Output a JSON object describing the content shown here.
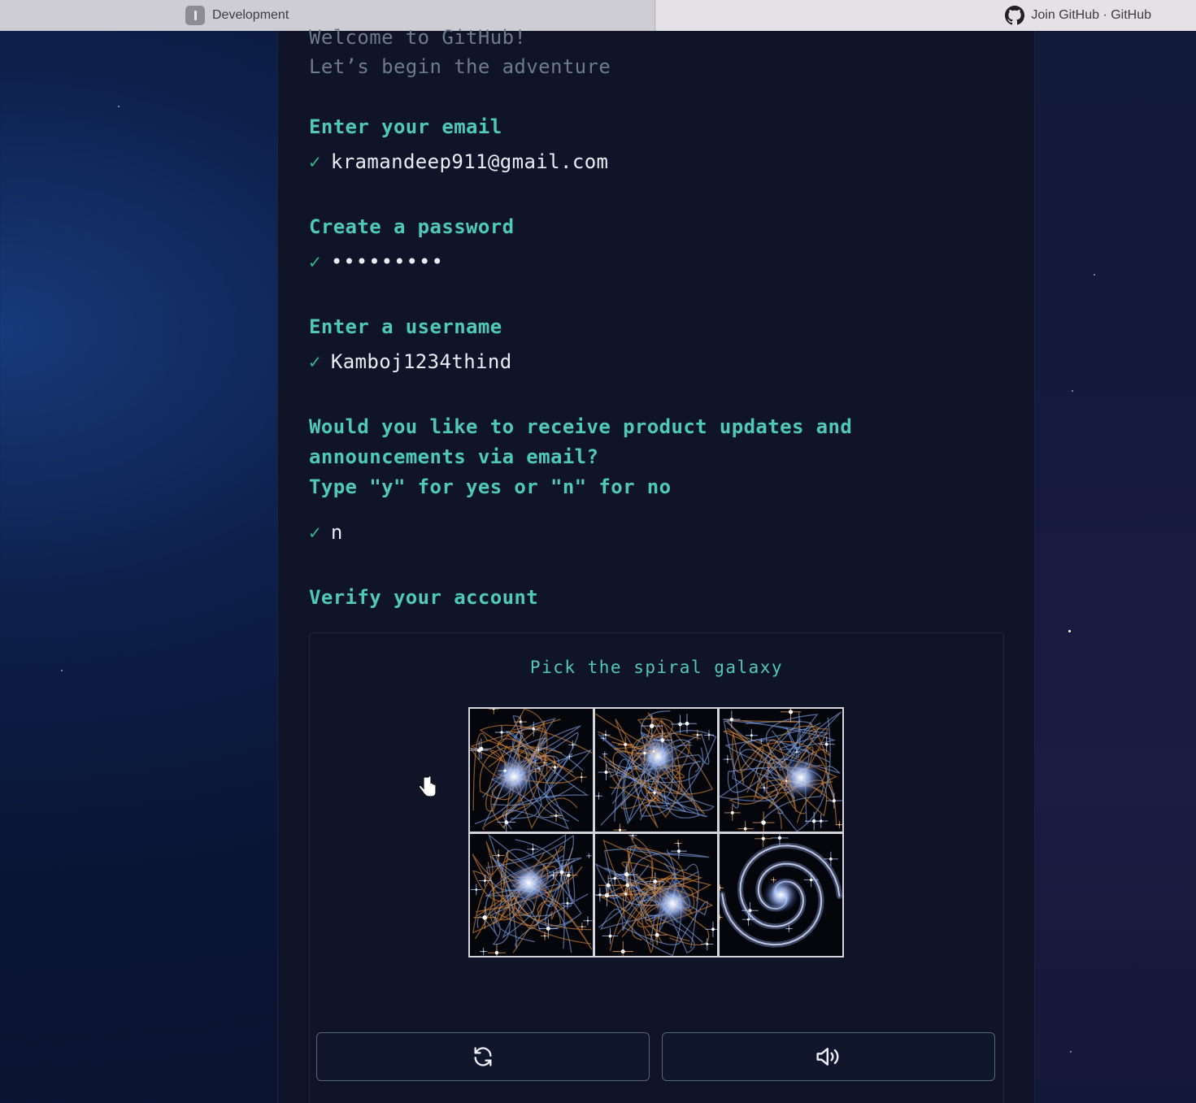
{
  "browser": {
    "tabs": [
      {
        "label": "Development",
        "icon": "development-favicon"
      },
      {
        "label": "Join GitHub · GitHub",
        "icon": "github-icon"
      }
    ]
  },
  "signup": {
    "welcome_line1": "Welcome to GitHub!",
    "welcome_line2": "Let’s begin the adventure",
    "email": {
      "prompt": "Enter your email",
      "value": "kramandeep911@gmail.com"
    },
    "password": {
      "prompt": "Create a password",
      "value": "•••••••••"
    },
    "username": {
      "prompt": "Enter a username",
      "value": "Kamboj1234thind"
    },
    "updates": {
      "prompt_line1": "Would you like to receive product updates and",
      "prompt_line2": "announcements via email?",
      "prompt_line3": "Type \"y\" for yes or \"n\" for no",
      "value": "n"
    },
    "check_symbol": "✓",
    "verify_prompt": "Verify your account"
  },
  "captcha": {
    "instruction": "Pick the spiral galaxy",
    "images": [
      {
        "name": "galaxy-option-1",
        "kind": "cluster"
      },
      {
        "name": "galaxy-option-2",
        "kind": "cluster"
      },
      {
        "name": "galaxy-option-3",
        "kind": "cluster"
      },
      {
        "name": "galaxy-option-4",
        "kind": "cluster"
      },
      {
        "name": "galaxy-option-5",
        "kind": "cluster"
      },
      {
        "name": "galaxy-option-6",
        "kind": "spiral"
      }
    ],
    "refresh_icon": "refresh-icon",
    "audio_icon": "speaker-icon"
  },
  "colors": {
    "prompt": "#4fc9b8",
    "check": "#35b08f",
    "panel_bg": "#0f1429"
  }
}
